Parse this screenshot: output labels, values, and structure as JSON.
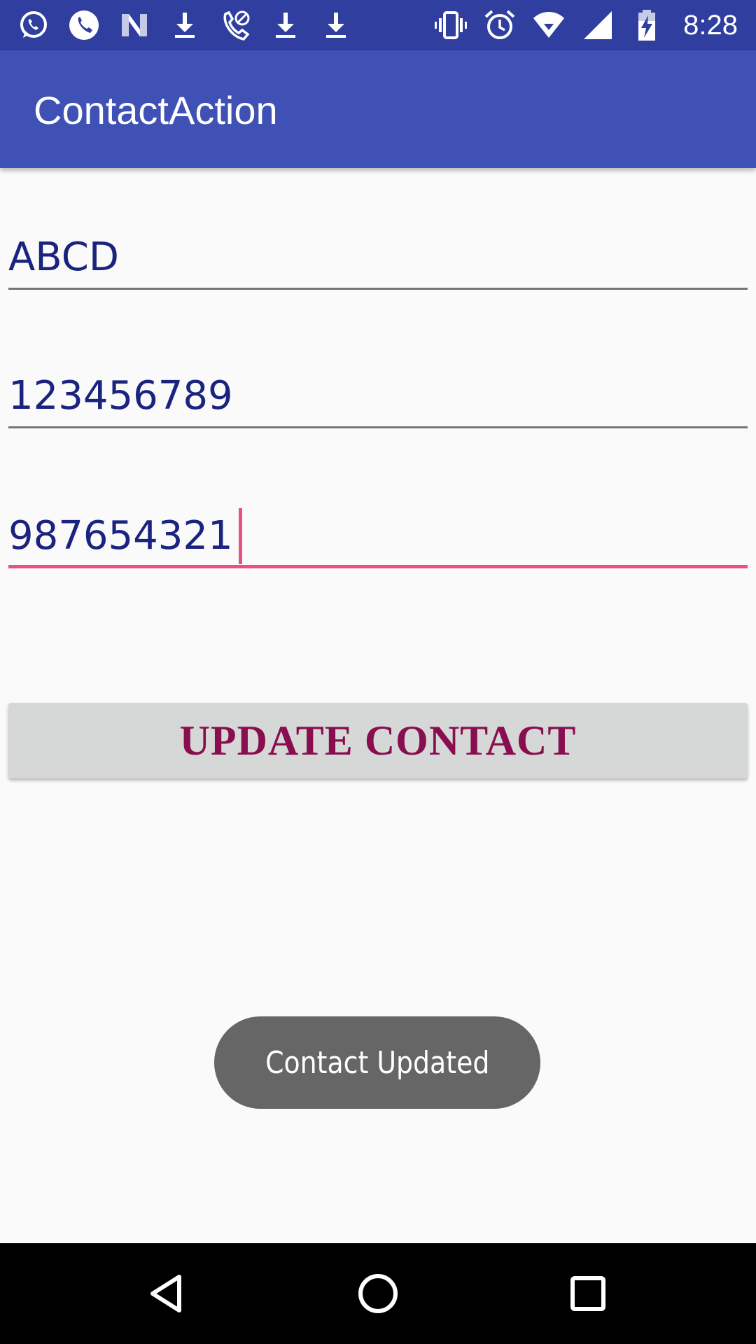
{
  "status_bar": {
    "time": "8:28",
    "left_icons": [
      "whatsapp-icon",
      "phone-icon",
      "news-icon",
      "download-icon",
      "missed-call-icon",
      "download-icon",
      "download-icon"
    ],
    "right_icons": [
      "vibrate-icon",
      "alarm-icon",
      "wifi-icon",
      "cell-signal-icon",
      "battery-charging-icon"
    ]
  },
  "app_bar": {
    "title": "ContactAction"
  },
  "form": {
    "name_value": "ABCD",
    "phone_value": "123456789",
    "new_phone_value": "987654321"
  },
  "button": {
    "label": "UPDATE CONTACT"
  },
  "toast": {
    "message": "Contact Updated"
  },
  "colors": {
    "status_bar": "#303f9f",
    "app_bar": "#3f51b5",
    "accent": "#e9508a",
    "input_text": "#1a237e",
    "button_text": "#880e4f",
    "button_bg": "#d6d7d7",
    "toast_bg": "#666666"
  },
  "nav_bar": {
    "icons": [
      "back-icon",
      "home-icon",
      "recents-icon"
    ]
  }
}
